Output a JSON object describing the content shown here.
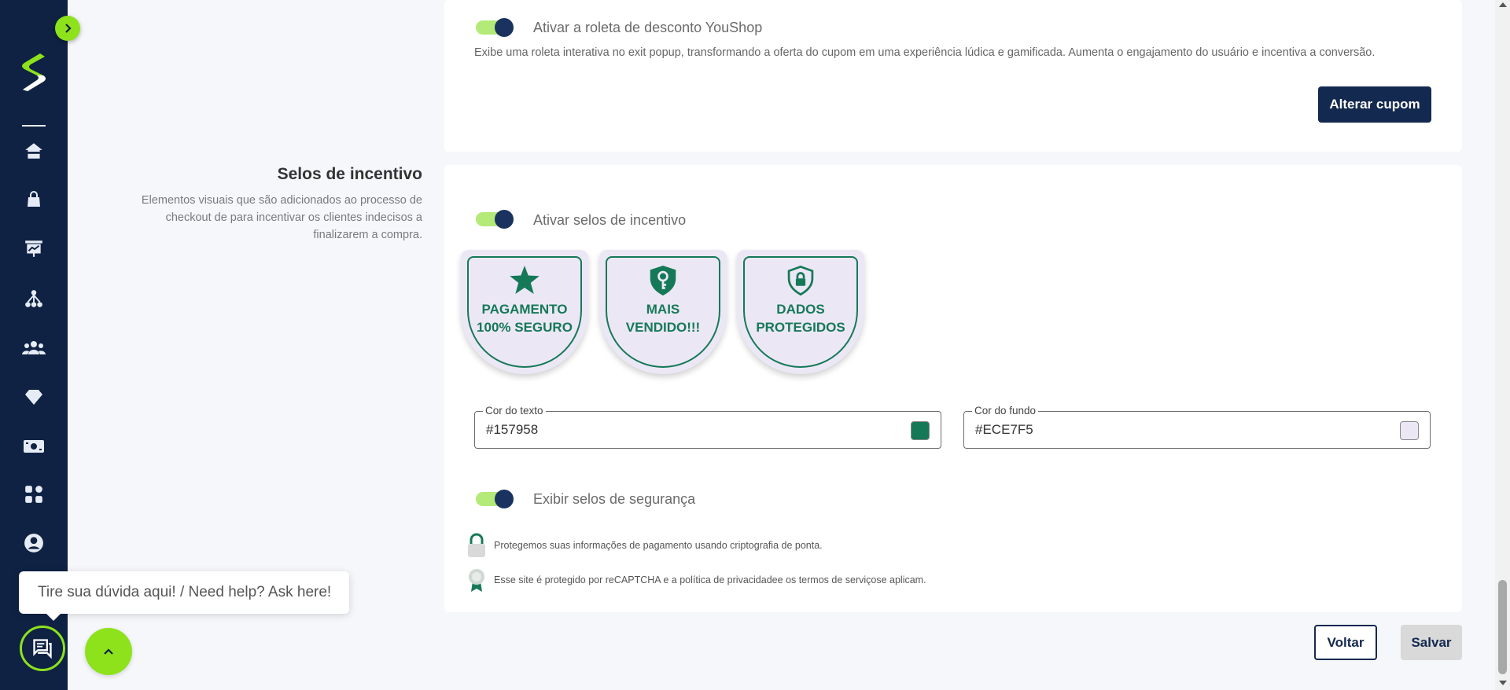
{
  "roleta": {
    "toggle_label": "Ativar a roleta de desconto YouShop",
    "description": "Exibe uma roleta interativa no exit popup, transformando a oferta do cupom em uma experiência lúdica e gamificada. Aumenta o engajamento do usuário e incentiva a conversão.",
    "change_coupon_label": "Alterar cupom",
    "enabled": true
  },
  "selos": {
    "title": "Selos de incentivo",
    "description": "Elementos visuais que são adicionados ao processo de checkout de para incentivar os clientes indecisos a finalizarem a compra.",
    "toggle_label": "Ativar selos de incentivo",
    "enabled": true,
    "badges": [
      {
        "icon": "star-icon",
        "line1": "PAGAMENTO",
        "line2": "100% SEGURO"
      },
      {
        "icon": "shield-key-icon",
        "line1": "MAIS",
        "line2": "VENDIDO!!!"
      },
      {
        "icon": "shield-lock-icon",
        "line1": "DADOS",
        "line2": "PROTEGIDOS"
      }
    ],
    "text_color": {
      "label": "Cor do texto",
      "value": "#157958"
    },
    "bg_color": {
      "label": "Cor do fundo",
      "value": "#ECE7F5"
    }
  },
  "seguranca": {
    "toggle_label": "Exibir selos de segurança",
    "enabled": true,
    "lines": [
      {
        "icon": "padlock-icon",
        "text": "Protegemos suas informações de pagamento usando criptografia de ponta."
      },
      {
        "icon": "award-ribbon-icon",
        "text": "Esse site é protegido por reCAPTCHA e a política de privacidadee os termos de serviçose aplicam."
      }
    ]
  },
  "footer": {
    "back_label": "Voltar",
    "save_label": "Salvar"
  },
  "help": {
    "tooltip": "Tire sua dúvida aqui! / Need help? Ask here!"
  },
  "colors": {
    "sidebar": "#0f2244",
    "accent_green": "#8de21c",
    "primary_navy": "#14294f",
    "badge_text": "#157958",
    "badge_bg": "#ECE7F5"
  },
  "sidebar": {
    "icons": [
      "home-icon",
      "bag-icon",
      "presentation-chart-icon",
      "network-icon",
      "users-icon",
      "diamond-icon",
      "money-icon",
      "apps-icon",
      "account-icon"
    ]
  }
}
